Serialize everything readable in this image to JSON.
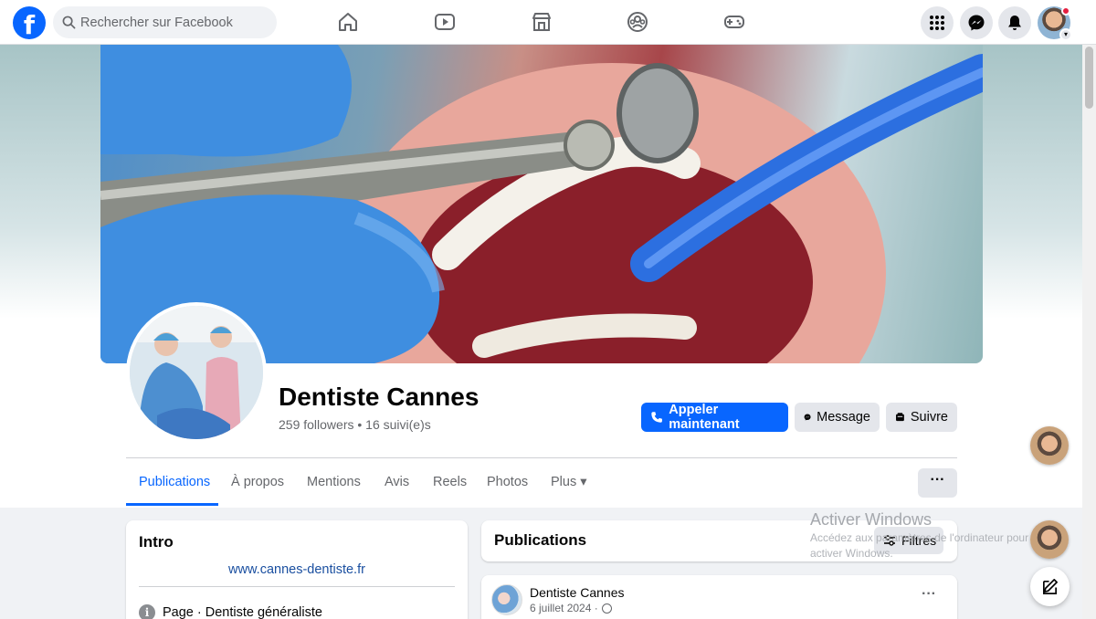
{
  "topbar": {
    "logo_letter": "f",
    "search_placeholder": "Rechercher sur Facebook",
    "nav_icons": [
      "home-icon",
      "video-icon",
      "marketplace-icon",
      "groups-icon",
      "gaming-icon"
    ],
    "right_icons": [
      "menu-grid-icon",
      "messenger-icon",
      "notifications-icon",
      "account-avatar"
    ]
  },
  "page": {
    "name": "Dentiste Cannes",
    "stats": "259 followers • 16 suivi(e)s",
    "actions": {
      "call": "Appeler maintenant",
      "message": "Message",
      "follow": "Suivre"
    }
  },
  "tabs": [
    {
      "label": "Publications",
      "active": true
    },
    {
      "label": "À propos"
    },
    {
      "label": "Mentions"
    },
    {
      "label": "Avis"
    },
    {
      "label": "Reels"
    },
    {
      "label": "Photos"
    },
    {
      "label": "Plus ▾"
    }
  ],
  "more_label": "···",
  "intro": {
    "title": "Intro",
    "website": "www.cannes-dentiste.fr",
    "info_prefix": "Page",
    "info_text": " · Dentiste généraliste"
  },
  "publications": {
    "title": "Publications",
    "filter_label": "Filtres",
    "post": {
      "author": "Dentiste Cannes",
      "date": "6 juillet 2024 ·",
      "more_label": "···"
    }
  },
  "windows_watermark": {
    "title": "Activer Windows",
    "subtitle_line1": "Accédez aux paramètres de l'ordinateur pour",
    "subtitle_line2": "activer Windows."
  },
  "colors": {
    "brand_blue": "#0866ff",
    "background": "#f0f2f5",
    "secondary_button": "#e4e6eb",
    "muted_text": "#65676b"
  }
}
